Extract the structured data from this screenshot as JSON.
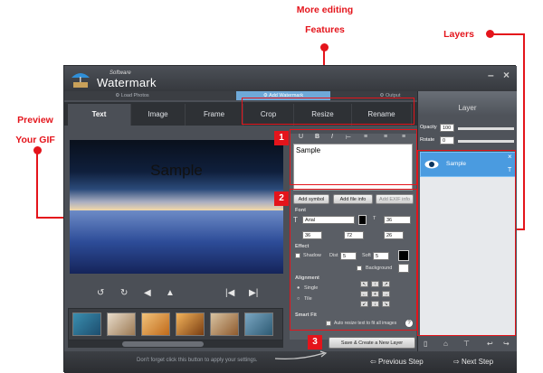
{
  "annotations": {
    "more_editing_line1": "More editing",
    "more_editing_line2": "Features",
    "layers": "Layers",
    "preview_line1": "Preview",
    "preview_line2": "Your GIF",
    "badge1": "1",
    "badge2": "2",
    "badge3": "3",
    "accent_color": "#e4141b"
  },
  "app": {
    "brand_small": "Software",
    "brand_title": "Watermark",
    "minimize": "–",
    "close": "×"
  },
  "steps": [
    "⚙ Load Photos",
    "⚙ Add  Watermark",
    "⚙ Output"
  ],
  "tabs": [
    "Text",
    "Image",
    "Frame",
    "Crop",
    "Resize",
    "Rename"
  ],
  "preview": {
    "watermark_text": "Sample"
  },
  "controls": [
    "↺",
    "↻",
    "◀",
    "▲",
    "|◀",
    "▶|"
  ],
  "format_toolbar": [
    "U",
    "B",
    "I",
    "⊢",
    "≡",
    "≡",
    "≡"
  ],
  "text_input": {
    "value": "Sample"
  },
  "buttons": {
    "add_symbol": "Add symbol",
    "add_file_info": "Add file info",
    "add_exif_info": "Add EXIF info",
    "save_create": "Save & Create a New Layer"
  },
  "font": {
    "heading": "Font",
    "family": "Arial",
    "size": "36",
    "field2": "36",
    "field3": "72",
    "field4": "26"
  },
  "effect": {
    "heading": "Effect",
    "shadow": "Shadow",
    "dist_label": "Dist",
    "dist_value": "5",
    "soft_label": "Soft",
    "soft_value": "5",
    "background": "Background"
  },
  "alignment": {
    "heading": "Alignment",
    "single": "Single",
    "tile": "Tile",
    "arrows": [
      "↖",
      "↑",
      "↗",
      "←",
      "+",
      "→",
      "↙",
      "↓",
      "↘"
    ]
  },
  "smart_fit": {
    "heading": "Smart Fit",
    "auto_resize": "Auto resize text to fit all images"
  },
  "layer_panel": {
    "title": "Layer",
    "opacity_label": "Opacity",
    "opacity_value": "100",
    "rotate_label": "Rotate",
    "rotate_value": "0",
    "item_name": "Sample",
    "item_type": "T"
  },
  "bottom": {
    "hint": "Don't forget click this button to apply your settings.",
    "previous": "Previous Step",
    "next": "Next Step"
  }
}
